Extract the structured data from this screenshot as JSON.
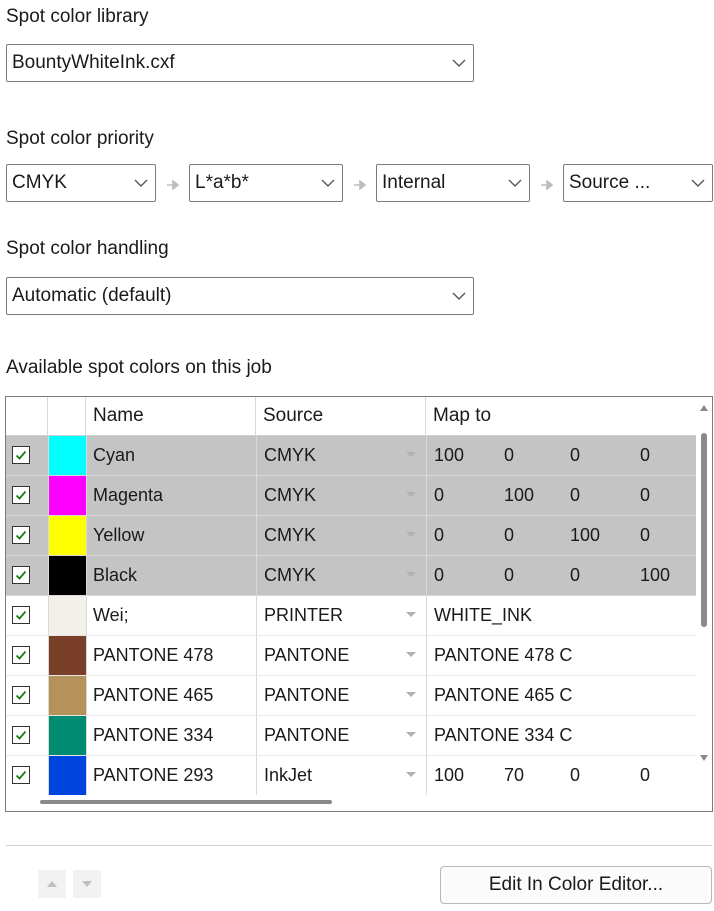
{
  "library": {
    "label": "Spot color library",
    "value": "BountyWhiteInk.cxf"
  },
  "priority": {
    "label": "Spot color priority",
    "items": [
      "CMYK",
      "L*a*b*",
      "Internal",
      "Source ..."
    ]
  },
  "handling": {
    "label": "Spot color handling",
    "value": "Automatic (default)"
  },
  "table": {
    "label": "Available spot colors on this job",
    "headers": {
      "name": "Name",
      "source": "Source",
      "map": "Map to"
    },
    "rows": [
      {
        "checked": true,
        "color": "#00ffff",
        "name": "Cyan",
        "source": "CMYK",
        "map": [
          "100",
          "0",
          "0",
          "0"
        ],
        "process": true
      },
      {
        "checked": true,
        "color": "#ff00ff",
        "name": "Magenta",
        "source": "CMYK",
        "map": [
          "0",
          "100",
          "0",
          "0"
        ],
        "process": true
      },
      {
        "checked": true,
        "color": "#ffff00",
        "name": "Yellow",
        "source": "CMYK",
        "map": [
          "0",
          "0",
          "100",
          "0"
        ],
        "process": true
      },
      {
        "checked": true,
        "color": "#000000",
        "name": "Black",
        "source": "CMYK",
        "map": [
          "0",
          "0",
          "0",
          "100"
        ],
        "process": true
      },
      {
        "checked": true,
        "color": "#f3efe9",
        "name": "Wei;",
        "source": "PRINTER",
        "map": [
          "WHITE_INK"
        ],
        "process": false
      },
      {
        "checked": true,
        "color": "#7a3f28",
        "name": "PANTONE 478",
        "source": "PANTONE",
        "map": [
          "PANTONE 478 C"
        ],
        "process": false
      },
      {
        "checked": true,
        "color": "#b4925a",
        "name": "PANTONE 465",
        "source": "PANTONE",
        "map": [
          "PANTONE 465 C"
        ],
        "process": false
      },
      {
        "checked": true,
        "color": "#008c72",
        "name": "PANTONE 334",
        "source": "PANTONE",
        "map": [
          "PANTONE 334 C"
        ],
        "process": false
      },
      {
        "checked": true,
        "color": "#0044e0",
        "name": "PANTONE 293",
        "source": "InkJet",
        "map": [
          "100",
          "70",
          "0",
          "0"
        ],
        "process": false
      }
    ]
  },
  "footer": {
    "edit_button": "Edit In Color Editor..."
  }
}
